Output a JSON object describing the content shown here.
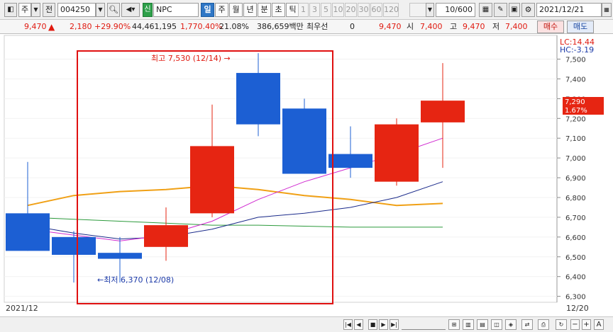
{
  "toolbar": {
    "market": "주",
    "range": "전",
    "code": "004250",
    "badge": "신",
    "name": "NPC",
    "periods": [
      "일",
      "주",
      "월",
      "년",
      "분",
      "초",
      "틱"
    ],
    "minutes": [
      "1",
      "3",
      "5",
      "10",
      "20",
      "30",
      "60",
      "120"
    ],
    "count": "10/600",
    "date": "2021/12/21"
  },
  "price_bar": {
    "price": "9,470",
    "change": "2,180",
    "change_pct": "+29.90%",
    "volume": "44,461,195",
    "volume_pct": "1,770.40%",
    "turnover": "21.08%",
    "amount": "386,659백만",
    "priority_label": "최우선",
    "priority_value": "0",
    "price2": "9,470",
    "open_label": "시",
    "open": "7,400",
    "high_label": "고",
    "high": "9,470",
    "low_label": "저",
    "low": "7,400",
    "buy": "매수",
    "sell": "매도"
  },
  "chart": {
    "lc_label": "LC:14.44",
    "hc_label": "HC:-3.19",
    "current_price": "7,290",
    "current_pct": "1.67%",
    "high_annotation": "최고 7,530 (12/14) →",
    "low_annotation": "←최저 6,370 (12/08)",
    "date_left": "2021/12",
    "date_right": "12/20",
    "colors": {
      "up": "#e62512",
      "down": "#1c5fd3",
      "ma_orange": "#f0a015",
      "ma_green": "#2c9a3c",
      "ma_navy": "#1a2a8a",
      "ma_magenta": "#d02ad0",
      "highlight": "#e01010"
    }
  },
  "chart_data": {
    "type": "candlestick",
    "ylim": [
      6270,
      7620
    ],
    "y_ticks": [
      "7,500",
      "7,400",
      "7,300",
      "7,200",
      "7,100",
      "7,000",
      "6,900",
      "6,800",
      "6,700",
      "6,600",
      "6,500",
      "6,400",
      "6,300"
    ],
    "candles": [
      {
        "open": 6720,
        "high": 6980,
        "low": 6530,
        "close": 6530
      },
      {
        "open": 6600,
        "high": 6630,
        "low": 6370,
        "close": 6510
      },
      {
        "open": 6520,
        "high": 6600,
        "low": 6370,
        "close": 6490
      },
      {
        "open": 6550,
        "high": 6750,
        "low": 6480,
        "close": 6660
      },
      {
        "open": 6720,
        "high": 7270,
        "low": 6700,
        "close": 7060
      },
      {
        "open": 7430,
        "high": 7530,
        "low": 7110,
        "close": 7170
      },
      {
        "open": 7250,
        "high": 7300,
        "low": 6920,
        "close": 6920
      },
      {
        "open": 7020,
        "high": 7160,
        "low": 6900,
        "close": 6950
      },
      {
        "open": 6880,
        "high": 7200,
        "low": 6860,
        "close": 7170
      },
      {
        "open": 7180,
        "high": 7480,
        "low": 6950,
        "close": 7290
      }
    ],
    "ma_orange": [
      6760,
      6810,
      6830,
      6840,
      6860,
      6840,
      6810,
      6790,
      6760,
      6770
    ],
    "ma_green": [
      6700,
      6690,
      6680,
      6670,
      6660,
      6660,
      6655,
      6650,
      6650,
      6650
    ],
    "ma_navy": [
      6660,
      6620,
      6590,
      6600,
      6640,
      6700,
      6720,
      6750,
      6800,
      6880
    ],
    "ma_magenta": [
      6640,
      6610,
      6580,
      6610,
      6680,
      6790,
      6880,
      6950,
      7020,
      7100
    ]
  }
}
